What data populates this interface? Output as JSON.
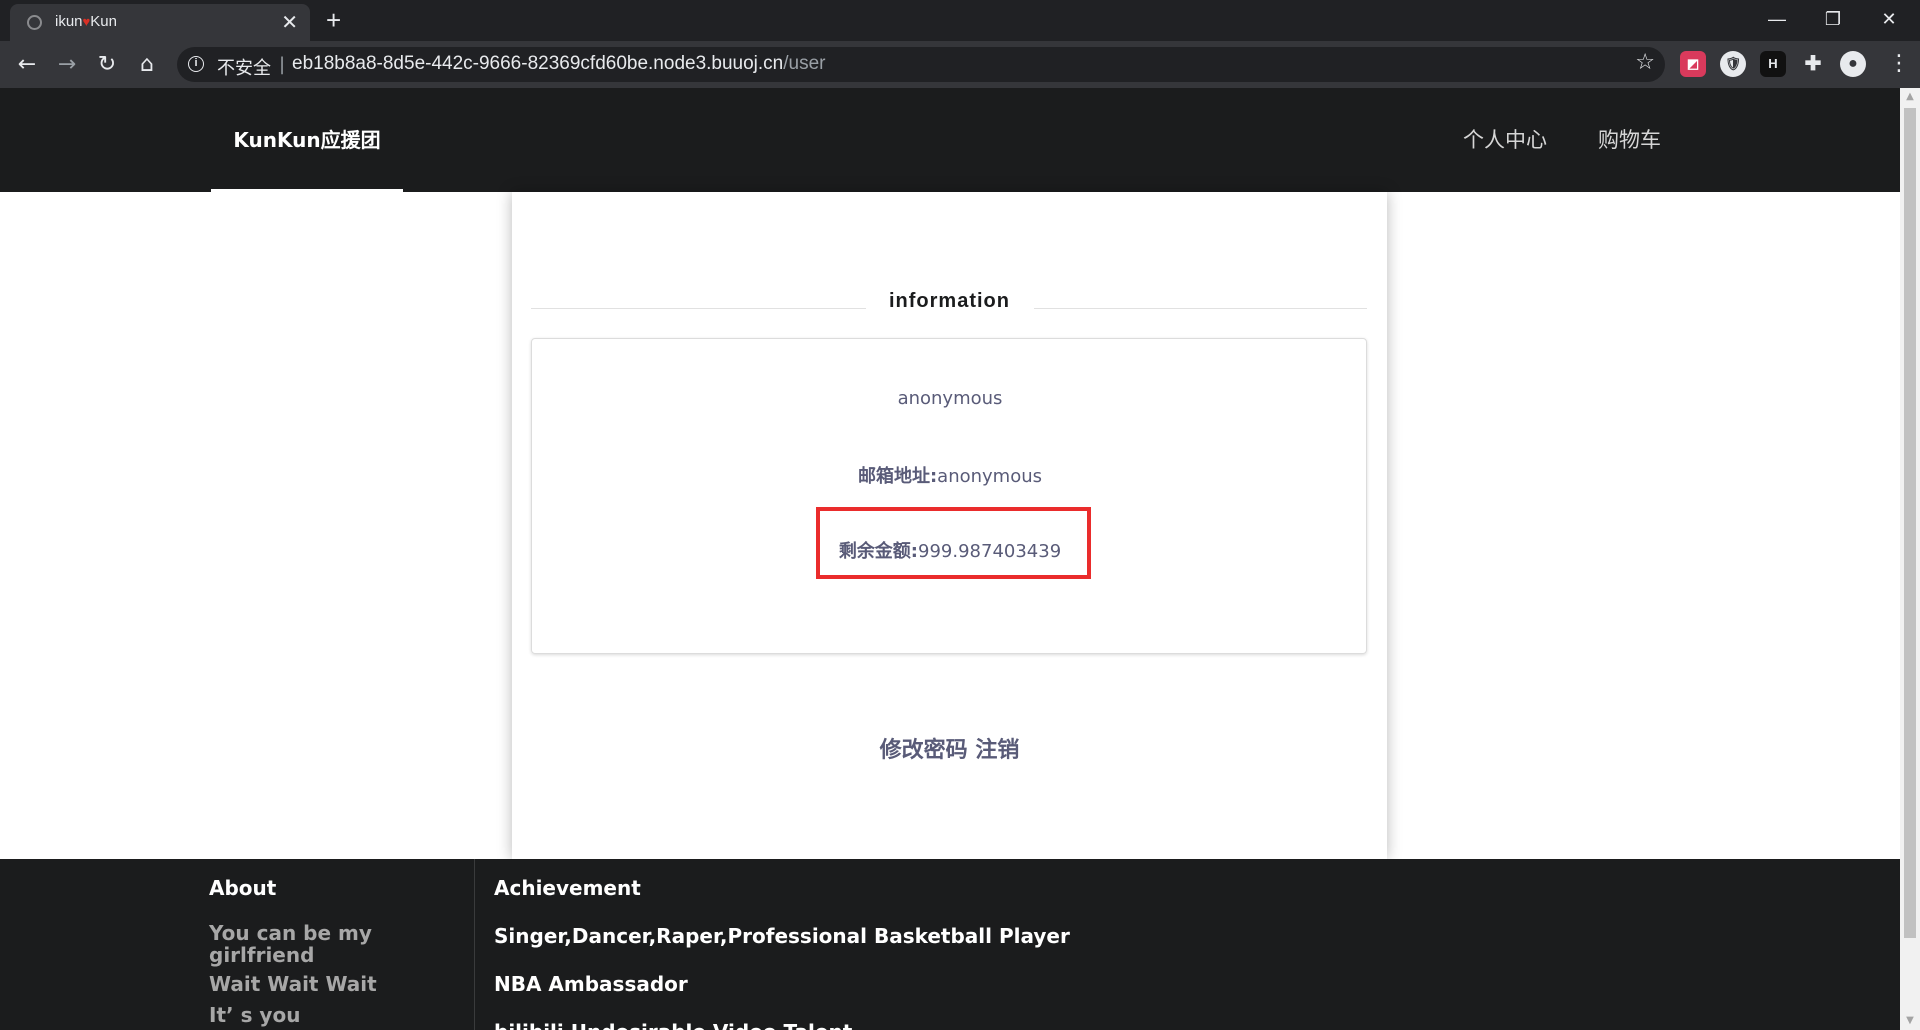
{
  "browser": {
    "tab": {
      "title_prefix": "ikun",
      "heart": "♥",
      "title_suffix": "Kun",
      "close": "✕"
    },
    "new_tab": "+",
    "window": {
      "minimize": "—",
      "restore": "❐",
      "close": "✕"
    },
    "nav": {
      "back": "←",
      "forward": "→",
      "reload": "↻",
      "home": "⌂"
    },
    "omnibox": {
      "info": "i",
      "security_label": "不安全",
      "separator": "|",
      "host": "eb18b8a8-8d5e-442c-9666-82369cfd60be.node3.buuoj.cn",
      "path": "/user"
    },
    "bookmark_star": "☆",
    "extensions": [
      {
        "name": "extension-1",
        "glyph": "◩",
        "color": "#d93a5c"
      },
      {
        "name": "extension-fox",
        "glyph": "🛡",
        "color": "#e8eaed"
      },
      {
        "name": "extension-h",
        "glyph": "H",
        "color": "#111111"
      },
      {
        "name": "extensions-puzzle",
        "glyph": "✚",
        "color": "#35363a"
      },
      {
        "name": "profile",
        "glyph": "●",
        "color": "#35363a"
      }
    ],
    "menu": "⋮"
  },
  "header": {
    "brand": "KunKun应援团",
    "nav": [
      "个人中心",
      "购物车"
    ]
  },
  "profile": {
    "section_title": "information",
    "username": "anonymous",
    "email_label": "邮箱地址:",
    "email_value": "anonymous",
    "balance_label": "剩余金额:",
    "balance_value": "999.987403439",
    "change_password": "修改密码",
    "logout": "注销"
  },
  "footer": {
    "about_title": "About",
    "about_items": [
      "You can be my girlfriend",
      "Wait Wait Wait",
      "It’ s you"
    ],
    "achievement_title": "Achievement",
    "achievement_items": [
      "Singer,Dancer,Raper,Professional Basketball Player",
      "NBA Ambassador",
      "bilibili Undesirable Video Talent"
    ]
  },
  "colors": {
    "header_bg": "#1b1c1d",
    "text_muted": "#595b78",
    "highlight": "#ea2c2c"
  }
}
